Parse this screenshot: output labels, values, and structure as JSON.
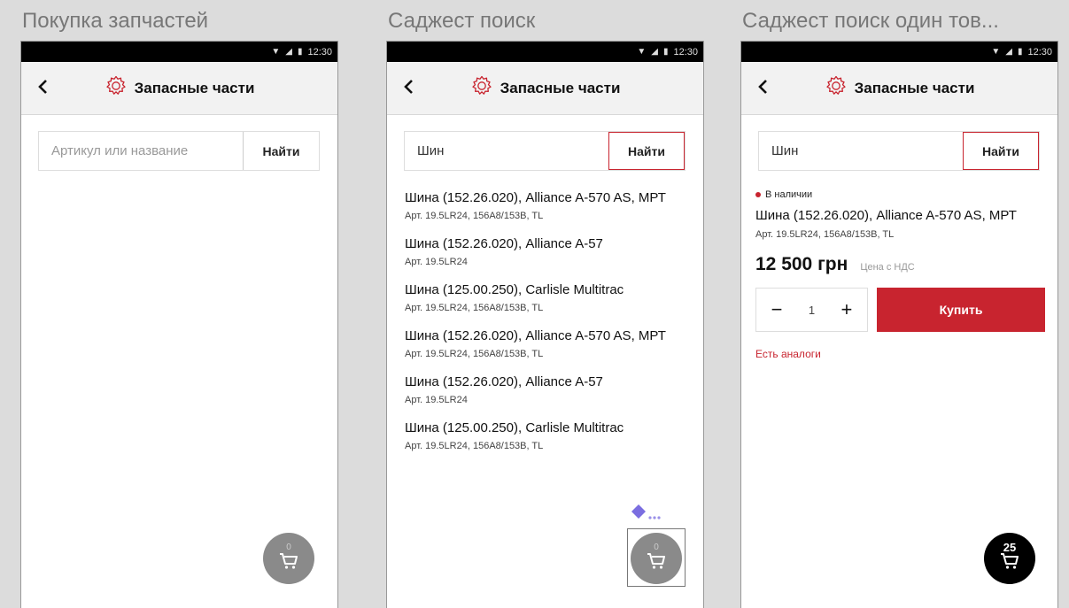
{
  "frames": [
    {
      "title": "Покупка запчастей",
      "status_time": "12:30",
      "app_title": "Запасные части",
      "search": {
        "placeholder": "Артикул или название",
        "value": "",
        "button": "Найти"
      },
      "cart_count": "0"
    },
    {
      "title": "Саджест поиск",
      "status_time": "12:30",
      "app_title": "Запасные части",
      "search": {
        "placeholder": "",
        "value": "Шин",
        "button": "Найти"
      },
      "suggestions": [
        {
          "name": "Шина (152.26.020), Alliance A-570 AS, МРТ",
          "art": "Арт. 19.5LR24, 156A8/153B, TL"
        },
        {
          "name": "Шина (152.26.020), Alliance A-57",
          "art": "Арт. 19.5LR24"
        },
        {
          "name": "Шина (125.00.250), Carlisle Multitrac",
          "art": "Арт. 19.5LR24, 156A8/153B, TL"
        },
        {
          "name": "Шина (152.26.020), Alliance A-570 AS, МРТ",
          "art": "Арт. 19.5LR24, 156A8/153B, TL"
        },
        {
          "name": "Шина (152.26.020), Alliance A-57",
          "art": "Арт. 19.5LR24"
        },
        {
          "name": "Шина (125.00.250), Carlisle Multitrac",
          "art": "Арт. 19.5LR24, 156A8/153B, TL"
        }
      ],
      "cart_count": "0"
    },
    {
      "title": "Саджест поиск один тов...",
      "status_time": "12:30",
      "app_title": "Запасные части",
      "search": {
        "placeholder": "",
        "value": "Шин",
        "button": "Найти"
      },
      "product": {
        "stock": "В наличии",
        "name": "Шина (152.26.020), Alliance A-570 AS, МРТ",
        "art": "Арт. 19.5LR24, 156A8/153B, TL",
        "price": "12 500 грн",
        "vat": "Цена с НДС",
        "qty": "1",
        "buy": "Купить",
        "analogs": "Есть аналоги"
      },
      "cart_count": "25"
    }
  ],
  "colors": {
    "accent": "#c8242f",
    "background": "#dcdcdc",
    "statusbar": "#000000",
    "appbar": "#f2f2f2"
  },
  "icons": [
    "back-arrow-icon",
    "gear-icon",
    "wifi-icon",
    "signal-icon",
    "battery-icon",
    "cart-icon",
    "plus-icon",
    "minus-icon"
  ]
}
